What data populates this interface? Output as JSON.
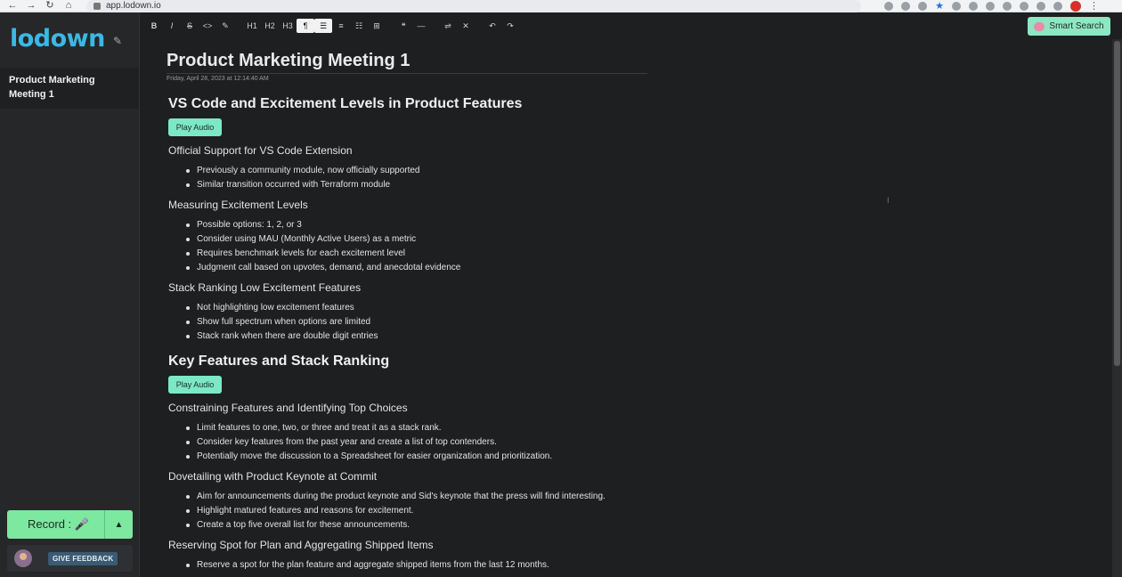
{
  "browser": {
    "url": "app.lodown.io"
  },
  "sidebar": {
    "logo": "lodown",
    "note_title": "Product Marketing Meeting 1",
    "record_label": "Record :",
    "feedback_label": "GIVE FEEDBACK"
  },
  "toolbar": {
    "buttons": [
      "B",
      "I",
      "S",
      "<>",
      "pen",
      "H1",
      "H2",
      "H3",
      "¶",
      "list",
      "ol",
      "task",
      "table",
      "quote",
      "hr",
      "wrap",
      "clear",
      "undo",
      "redo"
    ],
    "smart_search": "Smart Search"
  },
  "note": {
    "title": "Product Marketing Meeting 1",
    "date": "Friday, April 28, 2023 at 12:14:40 AM",
    "play_label": "Play Audio",
    "sections": [
      {
        "heading": "VS Code and Excitement Levels in Product Features",
        "subsections": [
          {
            "title": "Official Support for VS Code Extension",
            "bullets": [
              "Previously a community module, now officially supported",
              "Similar transition occurred with Terraform module"
            ]
          },
          {
            "title": "Measuring Excitement Levels",
            "bullets": [
              "Possible options: 1, 2, or 3",
              "Consider using MAU (Monthly Active Users) as a metric",
              "Requires benchmark levels for each excitement level",
              "Judgment call based on upvotes, demand, and anecdotal evidence"
            ]
          },
          {
            "title": "Stack Ranking Low Excitement Features",
            "bullets": [
              "Not highlighting low excitement features",
              "Show full spectrum when options are limited",
              "Stack rank when there are double digit entries"
            ]
          }
        ]
      },
      {
        "heading": "Key Features and Stack Ranking",
        "subsections": [
          {
            "title": "Constraining Features and Identifying Top Choices",
            "bullets": [
              "Limit features to one, two, or three and treat it as a stack rank.",
              "Consider key features from the past year and create a list of top contenders.",
              "Potentially move the discussion to a Spreadsheet for easier organization and prioritization."
            ]
          },
          {
            "title": "Dovetailing with Product Keynote at Commit",
            "bullets": [
              "Aim for announcements during the product keynote and Sid's keynote that the press will find interesting.",
              "Highlight matured features and reasons for excitement.",
              "Create a top five overall list for these announcements."
            ]
          },
          {
            "title": "Reserving Spot for Plan and Aggregating Shipped Items",
            "bullets": [
              "Reserve a spot for the plan feature and aggregate shipped items from the last 12 months."
            ]
          }
        ]
      }
    ]
  }
}
